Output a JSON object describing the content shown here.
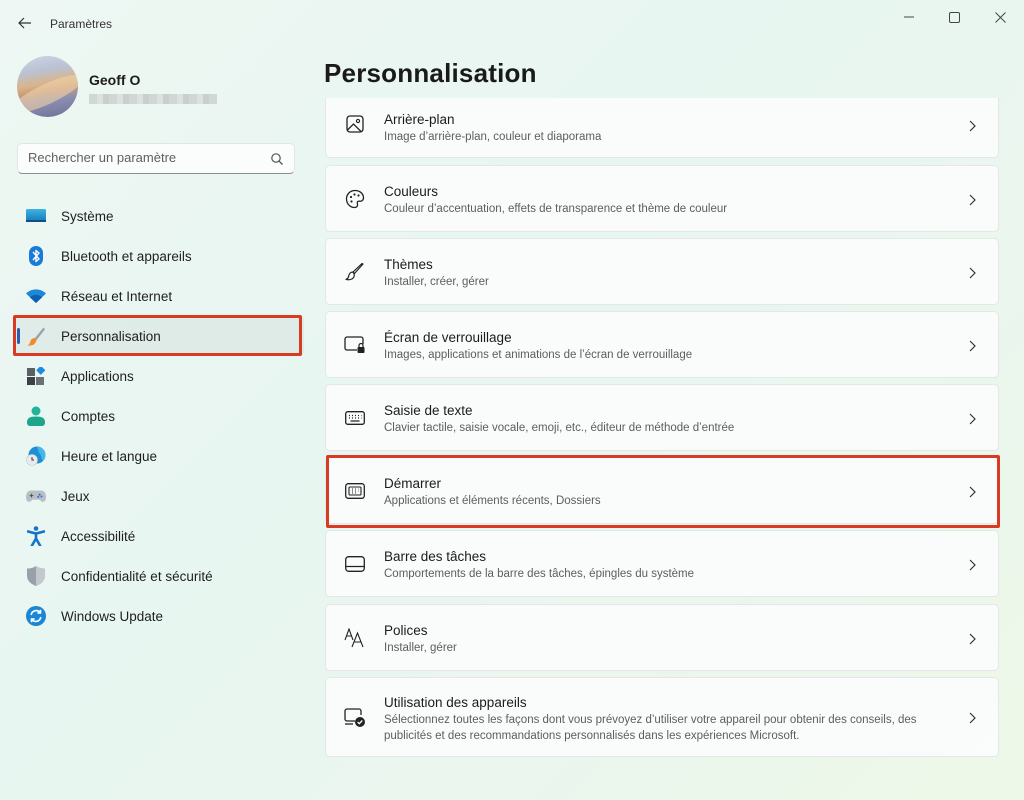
{
  "window": {
    "title": "Paramètres",
    "controls": {
      "minimize": "minimize",
      "maximize": "maximize",
      "close": "close"
    }
  },
  "profile": {
    "name": "Geoff O",
    "email_redacted": true
  },
  "search": {
    "placeholder": "Rechercher un paramètre",
    "value": ""
  },
  "sidebar": {
    "items": [
      {
        "label": "Système",
        "icon": "system-icon"
      },
      {
        "label": "Bluetooth et appareils",
        "icon": "bluetooth-icon"
      },
      {
        "label": "Réseau et Internet",
        "icon": "wifi-icon"
      },
      {
        "label": "Personnalisation",
        "icon": "paintbrush-icon",
        "active": true,
        "highlighted": true
      },
      {
        "label": "Applications",
        "icon": "apps-icon"
      },
      {
        "label": "Comptes",
        "icon": "account-icon"
      },
      {
        "label": "Heure et langue",
        "icon": "time-language-icon"
      },
      {
        "label": "Jeux",
        "icon": "gamepad-icon"
      },
      {
        "label": "Accessibilité",
        "icon": "accessibility-icon"
      },
      {
        "label": "Confidentialité et sécurité",
        "icon": "shield-icon"
      },
      {
        "label": "Windows Update",
        "icon": "update-icon"
      }
    ]
  },
  "main": {
    "title": "Personnalisation",
    "cards": [
      {
        "title": "Arrière-plan",
        "subtitle": "Image d’arrière-plan, couleur et diaporama",
        "icon": "image-icon"
      },
      {
        "title": "Couleurs",
        "subtitle": "Couleur d’accentuation, effets de transparence et thème de couleur",
        "icon": "palette-icon"
      },
      {
        "title": "Thèmes",
        "subtitle": "Installer, créer, gérer",
        "icon": "brush-icon"
      },
      {
        "title": "Écran de verrouillage",
        "subtitle": "Images, applications et animations de l’écran de verrouillage",
        "icon": "lock-screen-icon"
      },
      {
        "title": "Saisie de texte",
        "subtitle": "Clavier tactile, saisie vocale, emoji, etc., éditeur de méthode d’entrée",
        "icon": "keyboard-icon"
      },
      {
        "title": "Démarrer",
        "subtitle": "Applications et éléments récents, Dossiers",
        "icon": "start-icon",
        "highlighted": true
      },
      {
        "title": "Barre des tâches",
        "subtitle": "Comportements de la barre des tâches, épingles du système",
        "icon": "taskbar-icon"
      },
      {
        "title": "Polices",
        "subtitle": "Installer, gérer",
        "icon": "fonts-icon"
      },
      {
        "title": "Utilisation des appareils",
        "subtitle": "Sélectionnez toutes les façons dont vous prévoyez d’utiliser votre appareil pour obtenir des conseils, des publicités et des recommandations personnalisés dans les expériences Microsoft.",
        "icon": "device-usage-icon"
      }
    ]
  },
  "colors": {
    "accent": "#2b5fb3",
    "highlight_box": "#d93a23"
  }
}
